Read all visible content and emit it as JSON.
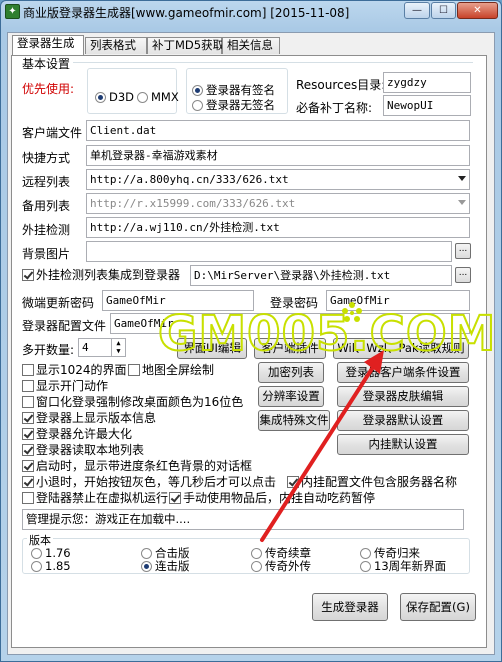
{
  "window": {
    "title": "商业版登录器生成器[www.gameofmir.com] [2015-11-08]"
  },
  "tabs": [
    "登录器生成",
    "列表格式",
    "补丁MD5获取",
    "相关信息"
  ],
  "basic_settings": {
    "title": "基本设置",
    "prefer_label": "优先使用:",
    "render_options": [
      "D3D",
      "MMX"
    ],
    "render_selected": "D3D",
    "signature_options": [
      "登录器有签名",
      "登录器无签名"
    ],
    "signature_selected": "登录器有签名",
    "resources_label": "Resources目录:",
    "resources_value": "zygdzy",
    "patch_label": "必备补丁名称:",
    "patch_value": "NewopUI",
    "client_label": "客户端文件",
    "client_value": "Client.dat",
    "shortcut_label": "快捷方式",
    "shortcut_value": "单机登录器-幸福游戏素材",
    "remote_label": "远程列表",
    "remote_value": "http://a.800yhq.cn/333/626.txt",
    "backup_label": "备用列表",
    "backup_value": "http://r.x15999.com/333/626.txt",
    "plugin_check_label": "外挂检测",
    "plugin_check_value": "http://a.wj110.cn/外挂检测.txt",
    "bg_label": "背景图片",
    "bg_value": "",
    "integrate_label": "外挂检测列表集成到登录器",
    "integrate_path": "D:\\MirServer\\登录器\\外挂检测.txt",
    "micro_update_label": "微端更新密码",
    "micro_update_value": "GameOfMir",
    "login_pwd_label": "登录密码",
    "login_pwd_value": "GameOfMir",
    "login_config_label": "登录器配置文件",
    "login_config_value": "GameOfMir",
    "multi_open_label": "多开数量:",
    "multi_open_value": "4",
    "browse_label": "..."
  },
  "options": [
    {
      "label": "显示1024的界面",
      "checked": false
    },
    {
      "label": "地图全屏绘制",
      "checked": false
    },
    {
      "label": "显示开门动作",
      "checked": false
    },
    {
      "label": "窗口化登录强制修改桌面颜色为16位色",
      "checked": false
    },
    {
      "label": "登录器上显示版本信息",
      "checked": true
    },
    {
      "label": "登录器允许最大化",
      "checked": true
    },
    {
      "label": "登录器读取本地列表",
      "checked": true
    },
    {
      "label": "启动时，显示带进度条红色背景的对话框",
      "checked": true
    },
    {
      "label": "小退时，开始按钮灰色，等几秒后才可以点击",
      "checked": true
    },
    {
      "label": "内挂配置文件包含服务器名称",
      "checked": true
    },
    {
      "label": "登陆器禁止在虚拟机运行",
      "checked": false
    },
    {
      "label": "手动使用物品后，内挂自动吃药暂停",
      "checked": true
    }
  ],
  "buttons": {
    "ui_editor": "界面UI编辑",
    "client_plugin": "客户端插件",
    "wil_read_rules": "Wil、Wzl、Pak读取规则",
    "encrypt_list": "加密列表",
    "client_conditions": "登录器客户端条件设置",
    "resolution": "分辨率设置",
    "skin_edit": "登录器皮肤编辑",
    "special_files": "集成特殊文件",
    "default_settings": "登录器默认设置",
    "plugin_defaults": "内挂默认设置",
    "generate": "生成登录器",
    "save_config": "保存配置(G)"
  },
  "admin_tip": {
    "label": "管理提示您：",
    "value": "游戏正在加载中...."
  },
  "version": {
    "title": "版本",
    "options": [
      "1.76",
      "合击版",
      "传奇续章",
      "传奇归来",
      "1.85",
      "连击版",
      "传奇外传",
      "13周年新界面"
    ],
    "selected": "连击版"
  },
  "watermark": "GM005.COM",
  "colors": {
    "accent_red": "#d00000",
    "arrow_red": "#e02020",
    "watermark": "#c8e000"
  }
}
